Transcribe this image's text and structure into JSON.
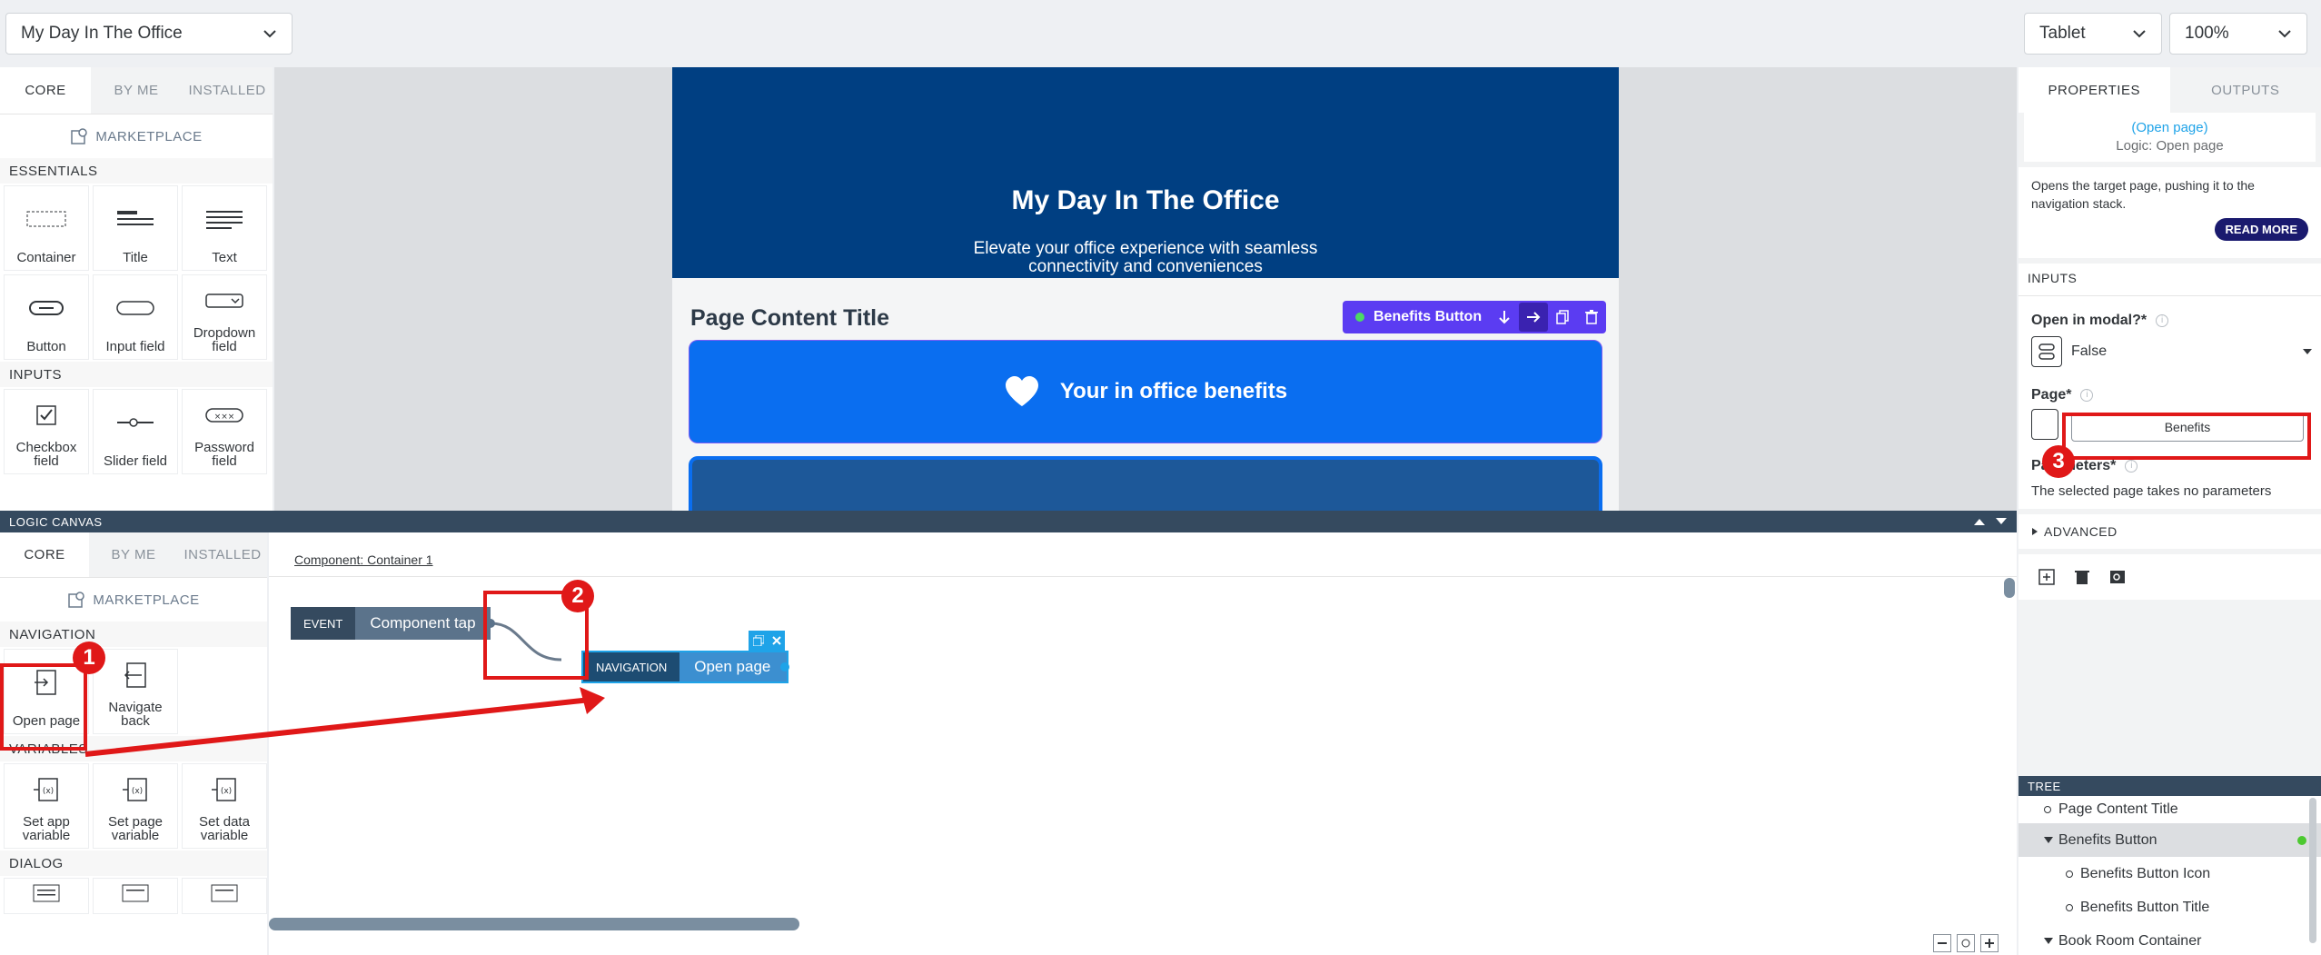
{
  "header": {
    "page_select": "My Day In The Office",
    "device_select": "Tablet",
    "zoom_select": "100%"
  },
  "components": {
    "tabs": [
      "CORE",
      "BY ME",
      "INSTALLED"
    ],
    "marketplace": "MARKETPLACE",
    "sections": {
      "essentials": "ESSENTIALS",
      "inputs": "INPUTS"
    },
    "essentials": [
      "Container",
      "Title",
      "Text",
      "Button",
      "Input field",
      "Dropdown field"
    ],
    "inputs": [
      "Checkbox field",
      "Slider field",
      "Password field"
    ]
  },
  "app": {
    "hero_title": "My Day In The Office",
    "hero_subtitle": "Elevate your office experience with seamless connectivity and conveniences",
    "page_content_title": "Page Content Title",
    "selected_badge": "Benefits Button",
    "benefits_label": "Your in office benefits"
  },
  "properties": {
    "tabs": [
      "PROPERTIES",
      "OUTPUTS"
    ],
    "flow_name": "(Open page)",
    "flow_sub": "Logic: Open page",
    "description": "Opens the target page, pushing it to the navigation stack.",
    "read_more": "READ MORE",
    "inputs_header": "INPUTS",
    "open_modal_label": "Open in modal?*",
    "open_modal_value": "False",
    "page_label": "Page*",
    "page_value": "Benefits",
    "params_label": "Parameters*",
    "params_text": "The selected page takes no parameters",
    "advanced": "ADVANCED"
  },
  "logic": {
    "bar_title": "LOGIC CANVAS",
    "tabs": [
      "CORE",
      "BY ME",
      "INSTALLED"
    ],
    "marketplace": "MARKETPLACE",
    "breadcrumb": "Component: Container 1",
    "sections": {
      "navigation": "NAVIGATION",
      "variables": "VARIABLES",
      "dialog": "DIALOG"
    },
    "navigation": [
      "Open page",
      "Navigate back"
    ],
    "variables": [
      "Set app variable",
      "Set page variable",
      "Set data variable"
    ],
    "event_node": {
      "tag": "EVENT",
      "label": "Component tap"
    },
    "nav_node": {
      "tag": "NAVIGATION",
      "label": "Open page"
    }
  },
  "tree": {
    "title": "TREE",
    "items": [
      "Page Content Title",
      "Benefits Button",
      "Benefits Button Icon",
      "Benefits Button Title",
      "Book Room Container"
    ]
  },
  "annotations": [
    "1",
    "2",
    "3"
  ],
  "colors": {
    "hero": "#003f82",
    "button": "#0a6ef0",
    "badge": "#5b3cf2",
    "annotation": "#e01818",
    "logic_bar": "#354a5f"
  }
}
